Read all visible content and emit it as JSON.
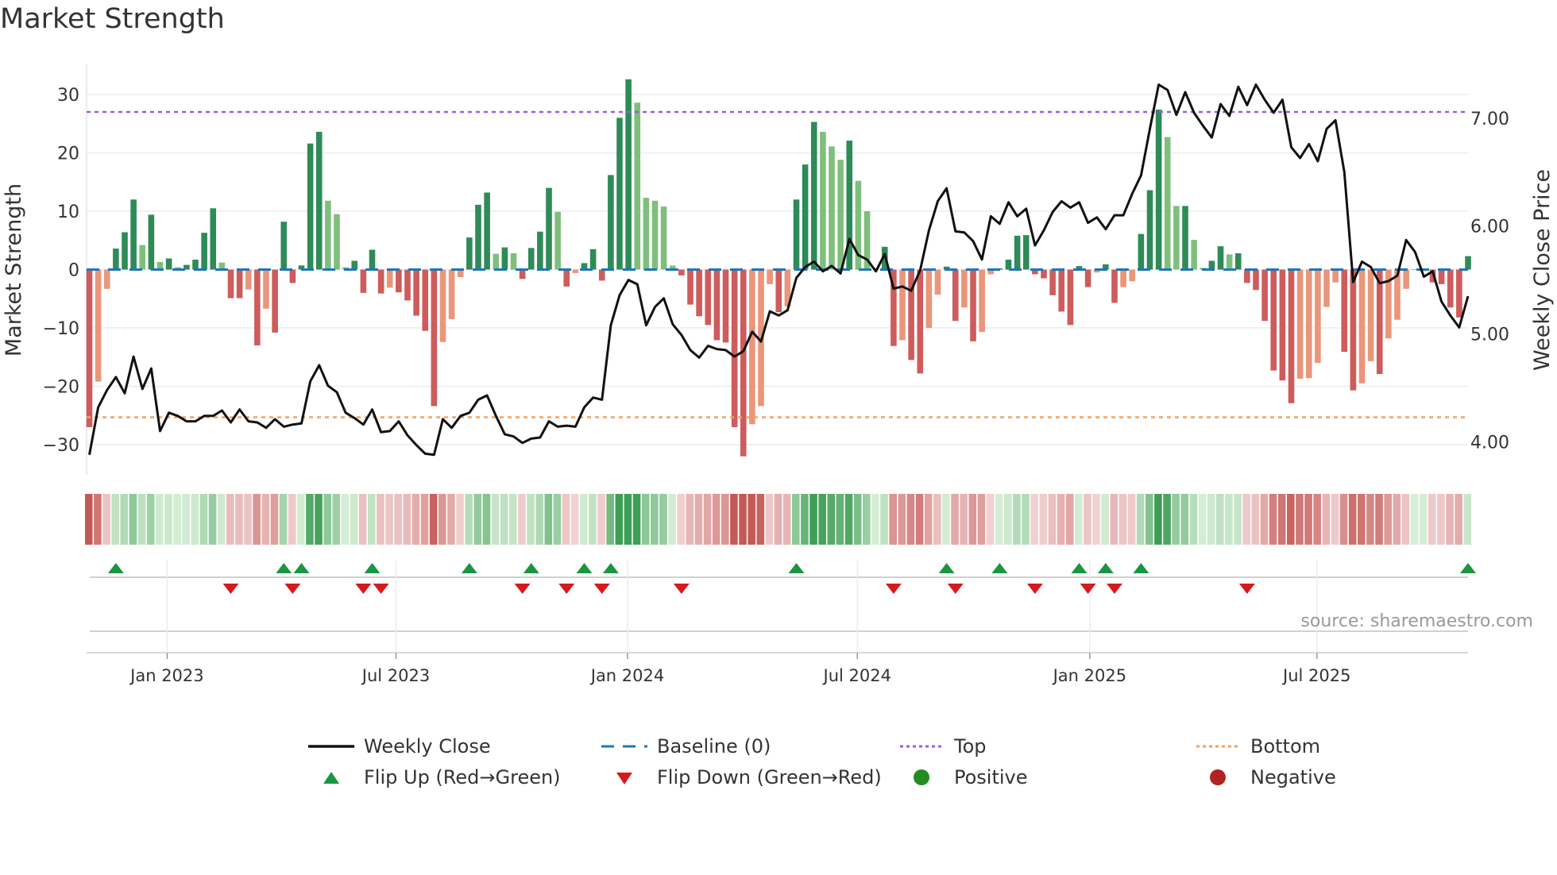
{
  "title": "Market Strength",
  "source": "source: sharemaestro.com",
  "legend": [
    {
      "label": "Weekly Close",
      "symbol": "solid-line",
      "color": "#111111"
    },
    {
      "label": "Baseline (0)",
      "symbol": "dashed-line",
      "color": "#1f77b4"
    },
    {
      "label": "Top",
      "symbol": "dotted-line",
      "color": "#9b5de5"
    },
    {
      "label": "Bottom",
      "symbol": "dotted-line",
      "color": "#f4a261"
    },
    {
      "label": "Flip Up (Red→Green)",
      "symbol": "triangle-up",
      "color": "#1a9641"
    },
    {
      "label": "Flip Down (Green→Red)",
      "symbol": "triangle-down",
      "color": "#d7191c"
    },
    {
      "label": "Positive",
      "symbol": "circle",
      "color": "#228b22"
    },
    {
      "label": "Negative",
      "symbol": "circle",
      "color": "#b22222"
    }
  ],
  "chart_data": {
    "type": "bar",
    "title": "Market Strength",
    "ylabel": "Market Strength",
    "y2label": "Weekly Close Price",
    "x_interval": "weekly",
    "x_ticks": [
      "Jan 2023",
      "Jul 2023",
      "Jan 2024",
      "Jul 2024",
      "Jan 2025",
      "Jul 2025"
    ],
    "x_tick_week_index": [
      9.8,
      35.7,
      61.9,
      87.9,
      114.2,
      139.9
    ],
    "ylim": [
      -35,
      35
    ],
    "y_ticks": [
      30,
      20,
      10,
      0,
      -10,
      -20,
      -30
    ],
    "y_tick_labels": [
      "30",
      "20",
      "10",
      "0",
      "−10",
      "−20",
      "−30"
    ],
    "y2_ticks": [
      7,
      6,
      5,
      4
    ],
    "y2_tick_labels": [
      "7.00",
      "6.00",
      "5.00",
      "4.00"
    ],
    "top_level": 27,
    "bottom_level": -25.3,
    "baseline": 0,
    "colors": {
      "pos_rising": "#2e8b57",
      "pos_falling": "#7fbf7b",
      "neg_falling": "#cd5c5c",
      "neg_rising": "#e9967a",
      "close": "#111111",
      "top": "#9b5de5",
      "bottom": "#f4a261",
      "baseline": "#1f77b4"
    },
    "strength": [
      -27,
      -19.2,
      -3.3,
      3.6,
      6.4,
      12,
      4.2,
      9.4,
      1.3,
      1.9,
      0.4,
      0.8,
      1.7,
      6.3,
      10.5,
      1.2,
      -4.9,
      -4.9,
      -3.4,
      -13,
      -6.7,
      -10.8,
      8.2,
      -2.3,
      0.7,
      21.6,
      23.6,
      11.8,
      9.5,
      0.4,
      1.5,
      -4,
      3.4,
      -4.1,
      -3.1,
      -3.9,
      -5.3,
      -7.9,
      -10.5,
      -23.4,
      -12.4,
      -8.5,
      -1.3,
      5.5,
      11.1,
      13.2,
      2.7,
      3.8,
      2.8,
      -1.6,
      3.7,
      6.5,
      14,
      9.9,
      -2.9,
      -0.6,
      1.1,
      3.5,
      -1.9,
      16.2,
      26,
      32.6,
      28.6,
      12.3,
      11.8,
      10.8,
      0.7,
      -1,
      -6,
      -8,
      -9.5,
      -12.1,
      -12.5,
      -27,
      -32,
      -26.5,
      -23.4,
      -2.5,
      -7.3,
      -6.3,
      12,
      18,
      25.3,
      23.6,
      21.1,
      18.8,
      22.1,
      15.2,
      10,
      0.2,
      3.9,
      -13.1,
      -12.1,
      -15.5,
      -17.8,
      -10,
      -4.3,
      0.5,
      -8.8,
      -6.5,
      -12.3,
      -10.7,
      -0.8,
      0.2,
      1.7,
      5.8,
      5.9,
      -0.8,
      -1.5,
      -4.4,
      -7.2,
      -9.5,
      0.6,
      -3,
      -0.5,
      0.9,
      -5.7,
      -3,
      -2,
      6.1,
      13.6,
      27.4,
      22.7,
      10.9,
      10.9,
      5.1,
      0.3,
      1.5,
      4,
      2.6,
      2.8,
      -2.3,
      -3.5,
      -8.8,
      -17.3,
      -19,
      -22.9,
      -18.7,
      -18.6,
      -16,
      -6.4,
      -2.2,
      -14.1,
      -20.7,
      -19.5,
      -15.7,
      -17.9,
      -11.8,
      -8.6,
      -3.3,
      0,
      0,
      -2.2,
      -2.5,
      -6.5,
      -8.2,
      2.3
    ],
    "weekly_close": [
      3.88,
      4.32,
      4.48,
      4.6,
      4.45,
      4.79,
      4.49,
      4.68,
      4.1,
      4.27,
      4.24,
      4.19,
      4.19,
      4.24,
      4.24,
      4.29,
      4.18,
      4.3,
      4.19,
      4.18,
      4.13,
      4.21,
      4.14,
      4.16,
      4.17,
      4.56,
      4.71,
      4.52,
      4.46,
      4.27,
      4.22,
      4.16,
      4.3,
      4.09,
      4.1,
      4.19,
      4.06,
      3.97,
      3.89,
      3.88,
      4.21,
      4.13,
      4.24,
      4.27,
      4.39,
      4.43,
      4.24,
      4.07,
      4.05,
      3.99,
      4.03,
      4.04,
      4.19,
      4.14,
      4.15,
      4.14,
      4.32,
      4.41,
      4.39,
      5.08,
      5.36,
      5.5,
      5.46,
      5.08,
      5.25,
      5.33,
      5.09,
      4.99,
      4.85,
      4.78,
      4.89,
      4.86,
      4.85,
      4.79,
      4.84,
      5.02,
      4.93,
      5.21,
      5.17,
      5.22,
      5.52,
      5.62,
      5.67,
      5.58,
      5.63,
      5.56,
      5.88,
      5.73,
      5.69,
      5.58,
      5.74,
      5.42,
      5.44,
      5.4,
      5.59,
      5.96,
      6.23,
      6.35,
      5.95,
      5.94,
      5.86,
      5.69,
      6.09,
      6.02,
      6.22,
      6.09,
      6.16,
      5.82,
      5.96,
      6.13,
      6.23,
      6.17,
      6.22,
      6.03,
      6.08,
      5.97,
      6.1,
      6.1,
      6.3,
      6.47,
      6.9,
      7.31,
      7.26,
      7.03,
      7.24,
      7.05,
      6.93,
      6.82,
      7.13,
      7.02,
      7.29,
      7.12,
      7.31,
      7.17,
      7.05,
      7.17,
      6.73,
      6.63,
      6.76,
      6.6,
      6.9,
      6.98,
      6.5,
      5.48,
      5.67,
      5.62,
      5.47,
      5.49,
      5.54,
      5.87,
      5.76,
      5.53,
      5.58,
      5.3,
      5.17,
      5.06,
      5.35
    ],
    "flip_up_weeks": [
      4,
      23,
      25,
      33,
      44,
      51,
      57,
      60,
      81,
      98,
      104,
      113,
      116,
      120,
      157
    ],
    "flip_down_weeks": [
      17,
      24,
      32,
      34,
      50,
      55,
      59,
      68,
      92,
      99,
      108,
      114,
      117,
      132
    ]
  }
}
